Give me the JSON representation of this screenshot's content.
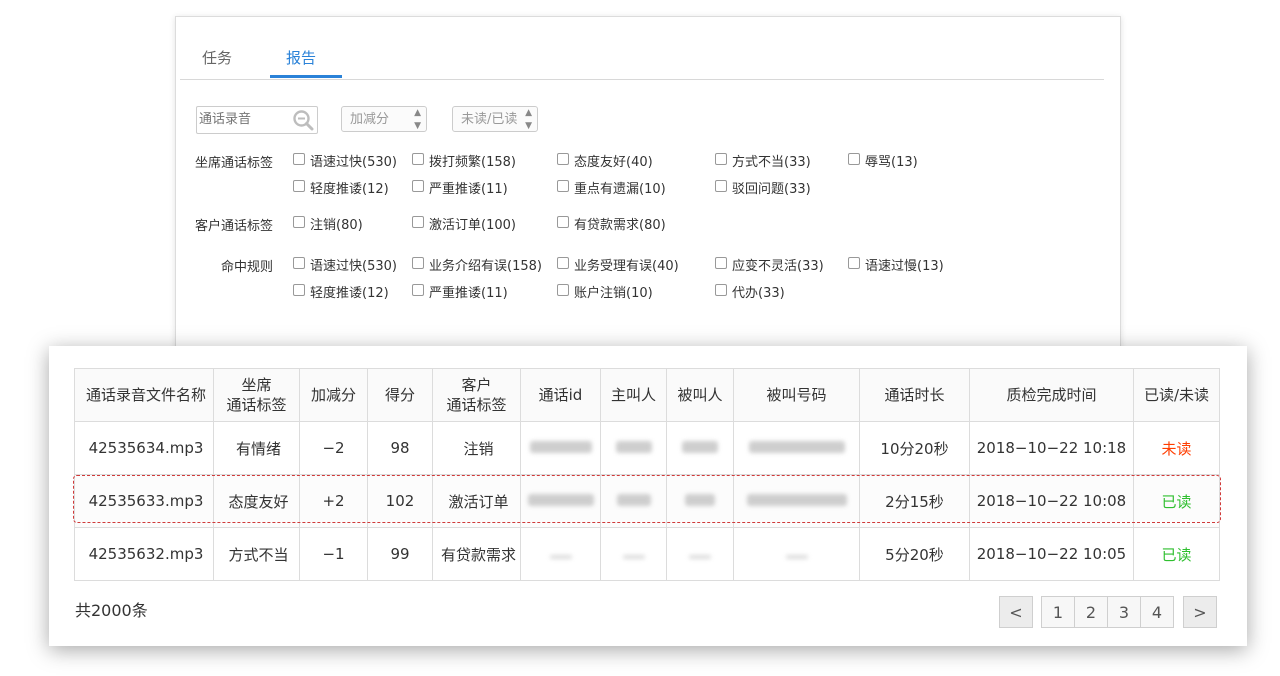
{
  "tabs": [
    {
      "label": "任务"
    },
    {
      "label": "报告"
    }
  ],
  "filters": {
    "search_placeholder": "通话录音",
    "select_score": "加减分",
    "select_read": "未读/已读"
  },
  "tag_groups": [
    {
      "label": "坐席通话标签",
      "rows": [
        [
          "语速过快(530)",
          "拨打频繁(158)",
          "态度友好(40)",
          "方式不当(33)",
          "辱骂(13)"
        ],
        [
          "轻度推诿(12)",
          "严重推诿(11)",
          "重点有遗漏(10)",
          "驳回问题(33)"
        ]
      ]
    },
    {
      "label": "客户通话标签",
      "rows": [
        [
          "注销(80)",
          "激活订单(100)",
          "有贷款需求(80)"
        ]
      ]
    },
    {
      "label": "命中规则",
      "rows": [
        [
          "语速过快(530)",
          "业务介绍有误(158)",
          "业务受理有误(40)",
          "应变不灵活(33)",
          "语速过慢(13)"
        ],
        [
          "轻度推诿(12)",
          "严重推诿(11)",
          "账户注销(10)",
          "代办(33)"
        ]
      ]
    }
  ],
  "table": {
    "headers": [
      "通话录音文件名称",
      "坐席\n通话标签",
      "加减分",
      "得分",
      "客户\n通话标签",
      "通话id",
      "主叫人",
      "被叫人",
      "被叫号码",
      "通话时长",
      "质检完成时间",
      "已读/未读"
    ],
    "rows": [
      {
        "file": "42535634.mp3",
        "agent_tag": "有情绪",
        "delta": "−2",
        "score": "98",
        "customer_tag": "注销",
        "duration": "10分20秒",
        "finished": "2018−10−22 10:18",
        "status": "未读"
      },
      {
        "file": "42535633.mp3",
        "agent_tag": "态度友好",
        "delta": "+2",
        "score": "102",
        "customer_tag": "激活订单",
        "duration": "2分15秒",
        "finished": "2018−10−22 10:08",
        "status": "已读"
      },
      {
        "file": "42535632.mp3",
        "agent_tag": "方式不当",
        "delta": "−1",
        "score": "99",
        "customer_tag": "有贷款需求",
        "duration": "5分20秒",
        "finished": "2018−10−22 10:05",
        "status": "已读"
      }
    ]
  },
  "footer": {
    "total": "共2000条",
    "pager": {
      "prev": "<",
      "pages": [
        "1",
        "2",
        "3",
        "4"
      ],
      "next": ">"
    }
  },
  "colors": {
    "accent": "#2a82d8",
    "unread": "#ff3d00",
    "read": "#2fbf2f",
    "highlight_border": "#d03a3a"
  }
}
